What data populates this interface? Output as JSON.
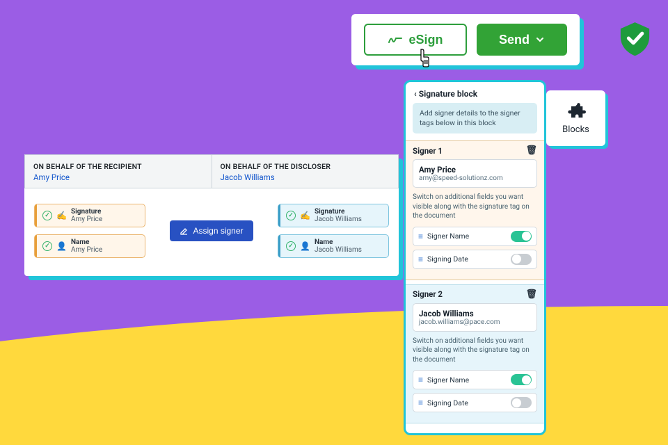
{
  "buttons": {
    "esign": "eSign",
    "send": "Send"
  },
  "doc": {
    "headers": [
      {
        "title": "ON BEHALF OF THE RECIPIENT",
        "name": "Amy Price"
      },
      {
        "title": "ON BEHALF OF THE DISCLOSER",
        "name": "Jacob Williams"
      }
    ],
    "left": [
      {
        "label": "Signature",
        "value": "Amy Price"
      },
      {
        "label": "Name",
        "value": "Amy Price"
      }
    ],
    "right": [
      {
        "label": "Signature",
        "value": "Jacob Williams"
      },
      {
        "label": "Name",
        "value": "Jacob Williams"
      }
    ],
    "assign": "Assign signer"
  },
  "sidepanel": {
    "back": "Signature block",
    "hint": "Add signer details to the signer tags below in this block",
    "note": "Switch on additional fields you want visible along with the signature tag on the document",
    "signers": [
      {
        "heading": "Signer 1",
        "name": "Amy Price",
        "email": "amy@speed-solutionz.com"
      },
      {
        "heading": "Signer 2",
        "name": "Jacob Williams",
        "email": "jacob.williams@pace.com"
      }
    ],
    "opts": {
      "signerName": "Signer Name",
      "signingDate": "Signing Date",
      "signerNameOn": true,
      "signingDateOn": false
    }
  },
  "blocks": {
    "label": "Blocks"
  }
}
